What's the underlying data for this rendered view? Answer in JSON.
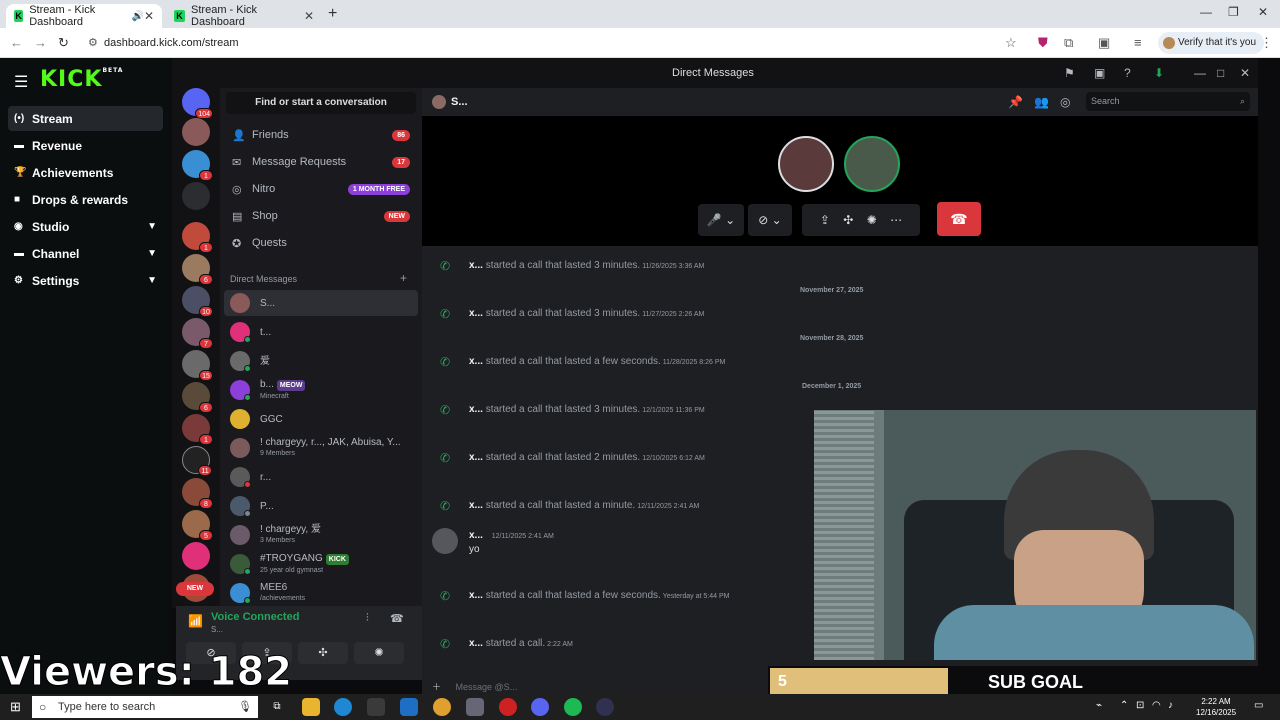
{
  "browser": {
    "tabs": [
      {
        "title": "Stream - Kick Dashboard",
        "active": true
      },
      {
        "title": "Stream - Kick Dashboard",
        "active": false
      }
    ],
    "url": "dashboard.kick.com/stream",
    "verify_label": "Verify that it's you"
  },
  "kick": {
    "logo": "KICK",
    "logo_badge": "BETA",
    "nav": [
      {
        "label": "Stream",
        "icon": "broadcast-icon",
        "active": true
      },
      {
        "label": "Revenue",
        "icon": "money-icon"
      },
      {
        "label": "Achievements",
        "icon": "trophy-icon"
      },
      {
        "label": "Drops & rewards",
        "icon": "gift-icon"
      },
      {
        "label": "Studio",
        "icon": "studio-icon",
        "expandable": true
      },
      {
        "label": "Channel",
        "icon": "channel-icon",
        "expandable": true
      },
      {
        "label": "Settings",
        "icon": "gear-icon",
        "expandable": true
      }
    ]
  },
  "discord": {
    "window_title": "Direct Messages",
    "server_badges": [
      "104",
      "",
      "1",
      "",
      "1",
      "6",
      "10",
      "7",
      "15",
      "6",
      "1",
      "11",
      "8",
      "5",
      "",
      ""
    ],
    "new_badge": "NEW",
    "find_conversation": "Find or start a conversation",
    "menu": [
      {
        "label": "Friends",
        "badge": "86"
      },
      {
        "label": "Message Requests",
        "badge": "17"
      },
      {
        "label": "Nitro",
        "badge": "1 MONTH FREE"
      },
      {
        "label": "Shop",
        "badge": "NEW"
      },
      {
        "label": "Quests",
        "badge": ""
      }
    ],
    "dm_header": "Direct Messages",
    "dms": [
      {
        "name": "S...",
        "sub": "",
        "tag": ""
      },
      {
        "name": "t...",
        "sub": "",
        "tag": ""
      },
      {
        "name": "爱",
        "sub": "",
        "tag": ""
      },
      {
        "name": "b...",
        "sub": "Minecraft",
        "tag": "MEOW"
      },
      {
        "name": "GGC",
        "sub": "",
        "tag": ""
      },
      {
        "name": "! chargeyy, r..., JAK, Abuisa, Y...",
        "sub": "9 Members",
        "tag": ""
      },
      {
        "name": "r...",
        "sub": "",
        "tag": ""
      },
      {
        "name": "P...",
        "sub": "",
        "tag": ""
      },
      {
        "name": "! chargeyy, 爱",
        "sub": "3 Members",
        "tag": ""
      },
      {
        "name": "#TROYGANG",
        "sub": "25 year old gymnast",
        "tag": "KICK"
      },
      {
        "name": "MEE6",
        "sub": "/achievements",
        "tag": ""
      }
    ],
    "voice": {
      "status": "Voice Connected",
      "channel": "S..."
    },
    "chat": {
      "recipient": "S...",
      "search_placeholder": "Search",
      "input_placeholder": "Message @S...",
      "date_separators": [
        "November 27, 2025",
        "November 28, 2025",
        "December 1, 2025"
      ],
      "messages": [
        {
          "who": "x...",
          "text": "started a call that lasted 3 minutes.",
          "time": "11/26/2025 3:36 AM"
        },
        {
          "who": "x...",
          "text": "started a call that lasted 3 minutes.",
          "time": "11/27/2025 2:26 AM"
        },
        {
          "who": "x...",
          "text": "started a call that lasted a few seconds.",
          "time": "11/28/2025 8:26 PM"
        },
        {
          "who": "x...",
          "text": "started a call that lasted 3 minutes.",
          "time": "12/1/2025 11:36 PM"
        },
        {
          "who": "x...",
          "text": "started a call that lasted 2 minutes.",
          "time": "12/10/2025 6:12 AM"
        },
        {
          "who": "x...",
          "text": "started a call that lasted a minute.",
          "time": "12/11/2025 2:41 AM"
        },
        {
          "who": "x...",
          "text": "started a call that lasted a few seconds.",
          "time": "Yesterday at 5:44 PM"
        },
        {
          "who": "x...",
          "text": "started a call.",
          "time": "2:22 AM"
        }
      ],
      "chat_message": {
        "who": "x...",
        "time": "12/11/2025 2:41 AM",
        "text": "yo"
      }
    }
  },
  "overlay": {
    "viewers": "Viewers: 182",
    "sub_goal_count": "5",
    "sub_goal_label": "SUB GOAL",
    "sub_goal_progress": 0.36
  },
  "taskbar": {
    "search_placeholder": "Type here to search",
    "time": "2:22 AM",
    "date": "12/16/2025"
  }
}
